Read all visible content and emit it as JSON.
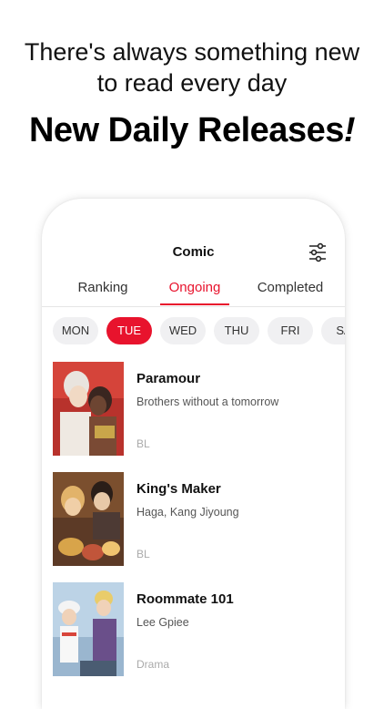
{
  "promo": {
    "tagline_line1": "There's always something new",
    "tagline_line2": "to read every day",
    "headline": "New  Daily Releases",
    "headline_bang": "!"
  },
  "app": {
    "title": "Comic",
    "filter_icon": "sliders-icon",
    "tabs": [
      {
        "label": "Ranking",
        "active": false
      },
      {
        "label": "Ongoing",
        "active": true
      },
      {
        "label": "Completed",
        "active": false
      }
    ],
    "days": [
      {
        "label": "MON",
        "active": false
      },
      {
        "label": "TUE",
        "active": true
      },
      {
        "label": "WED",
        "active": false
      },
      {
        "label": "THU",
        "active": false
      },
      {
        "label": "FRI",
        "active": false
      },
      {
        "label": "SA",
        "active": false
      }
    ],
    "comics": [
      {
        "title": "Paramour",
        "subtitle": "Brothers without a tomorrow",
        "genre": "BL"
      },
      {
        "title": "King's Maker",
        "subtitle": "Haga, Kang Jiyoung",
        "genre": "BL"
      },
      {
        "title": "Roommate 101",
        "subtitle": "Lee Gpiee",
        "genre": "Drama"
      }
    ]
  },
  "colors": {
    "accent": "#e8132d",
    "pill_bg": "#f0f0f2"
  }
}
